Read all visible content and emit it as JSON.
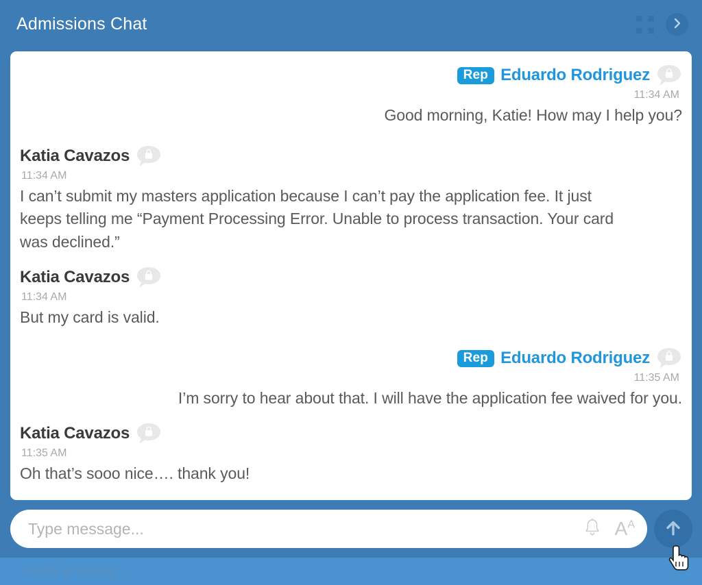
{
  "header": {
    "title": "Admissions Chat",
    "expand_icon": "expand-arrows-icon",
    "chevron_icon": "chevron-right-icon"
  },
  "colors": {
    "app_background": "#3d7cb5",
    "panel_background": "#ffffff",
    "rep_badge": "#1a9bdc",
    "rep_name": "#2196dd",
    "guest_name": "#3a3a3a",
    "body_text": "#5a5a5a",
    "timestamp": "#a9a9a9",
    "typing_bar": "#4a93d0",
    "send_button": "#3370a8"
  },
  "messages": [
    {
      "id": "msg-1",
      "side": "right",
      "badge": "Rep",
      "sender": "Eduardo Rodriguez",
      "time": "11:34 AM",
      "text": "Good morning, Katie! How may I help you?",
      "avatar": "locked-chat-avatar-icon"
    },
    {
      "id": "msg-2",
      "side": "left",
      "badge": null,
      "sender": "Katia Cavazos",
      "time": "11:34 AM",
      "text": "I can’t submit my masters application because I can’t pay the application fee. It just keeps telling me “Payment Processing Error. Unable to process transaction. Your card was declined.”",
      "avatar": "locked-chat-avatar-icon"
    },
    {
      "id": "msg-3",
      "side": "left",
      "badge": null,
      "sender": "Katia Cavazos",
      "time": "11:34 AM",
      "text": "But my card is valid.",
      "avatar": "locked-chat-avatar-icon"
    },
    {
      "id": "msg-4",
      "side": "right",
      "badge": "Rep",
      "sender": "Eduardo Rodriguez",
      "time": "11:35 AM",
      "text": "I’m sorry to hear about that.  I will have the application fee waived for you.",
      "avatar": "locked-chat-avatar-icon"
    },
    {
      "id": "msg-5",
      "side": "left",
      "badge": null,
      "sender": "Katia Cavazos",
      "time": "11:35 AM",
      "text": "Oh that’s sooo nice…. thank you!",
      "avatar": "locked-chat-avatar-icon"
    }
  ],
  "composer": {
    "placeholder": "Type message...",
    "value": "",
    "bell_icon": "bell-icon",
    "font_size_icon_main": "A",
    "font_size_icon_sup": "A",
    "send_icon": "arrow-up-icon"
  },
  "status": {
    "typing": "Katia is typing..."
  }
}
